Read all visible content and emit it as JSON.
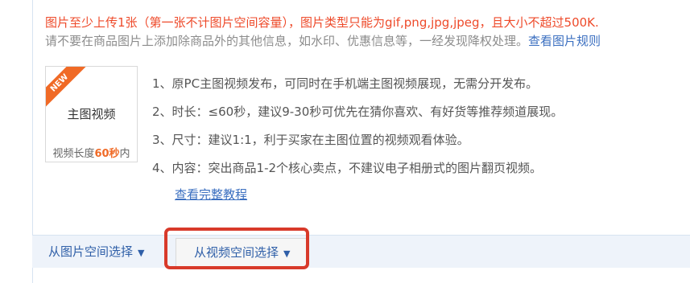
{
  "notice": {
    "line1": "图片至少上传1张（第一张不计图片空间容量），图片类型只能为gif,png,jpg,jpeg，且大小不超过500K.",
    "line2": "请不要在商品图片上添加除商品外的其他信息，如水印、优惠信息等，一经发现降权处理。",
    "rules_link": "查看图片规则"
  },
  "thumb": {
    "badge": "NEW",
    "title": "主图视频",
    "subtitle_prefix": "视频长度",
    "subtitle_value": "60秒",
    "subtitle_suffix": "内"
  },
  "items": [
    "1、原PC主图视频发布，可同时在手机端主图视频展现，无需分开发布。",
    "2、时长：≤60秒，建议9-30秒可优先在猜你喜欢、有好货等推荐频道展现。",
    "3、尺寸：建议1:1，利于买家在主图位置的视频观看体验。",
    "4、内容：突出商品1-2个核心卖点，不建议电子相册式的图片翻页视频。"
  ],
  "tutorial_link": "查看完整教程",
  "bottom": {
    "image_space_label": "从图片空间选择",
    "video_space_label": "从视频空间选择"
  },
  "colors": {
    "warning_text": "#ee4a2a",
    "link": "#3b6fc0",
    "badge": "#f06a26",
    "highlight_box": "#d83a2a"
  }
}
